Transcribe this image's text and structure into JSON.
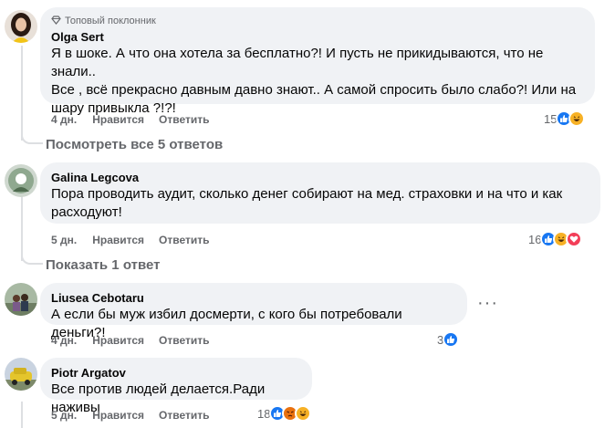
{
  "comments": [
    {
      "author": "Olga Sert",
      "badge": "Топовый поклонник",
      "badge_icon": "diamond-icon",
      "text_lines": [
        "Я в шоке. А что она хотела за бесплатно?! И пусть не прикидываются, что не знали..",
        "Все , всё прекрасно давным давно знают.. А самой спросить было слабо?! Или на",
        "шару привыкла ?!?!"
      ],
      "time": "4 дн.",
      "like_label": "Нравится",
      "reply_label": "Ответить",
      "reaction_count": "15",
      "reactions": [
        "like",
        "haha"
      ],
      "replies_link": "Посмотреть все 5 ответов"
    },
    {
      "author": "Galina Legcova",
      "text_lines": [
        "Пора проводить аудит, сколько денег собирают на мед. страховки и на что и как",
        "расходуют!"
      ],
      "time": "5 дн.",
      "like_label": "Нравится",
      "reply_label": "Ответить",
      "reaction_count": "16",
      "reactions": [
        "like",
        "haha",
        "love"
      ],
      "replies_link": "Показать 1 ответ"
    },
    {
      "author": "Liusea Cebotaru",
      "text_lines": [
        "А если бы муж избил досмерти, с кого бы потребовали деньги?!"
      ],
      "time": "4 дн.",
      "like_label": "Нравится",
      "reply_label": "Ответить",
      "reaction_count": "3",
      "reactions": [
        "like"
      ],
      "more_label": "···"
    },
    {
      "author": "Piotr Argatov",
      "text_lines": [
        "Все против людей делается.Ради наживы"
      ],
      "time": "5 дн.",
      "like_label": "Нравится",
      "reply_label": "Ответить",
      "reaction_count": "18",
      "reactions": [
        "like",
        "angry",
        "haha"
      ]
    }
  ],
  "colors": {
    "like": "#1877f2",
    "love": "#f33e58",
    "haha": "#f7b125",
    "angry": "#e9710f",
    "bubble": "#f0f2f5",
    "meta": "#65676b"
  }
}
